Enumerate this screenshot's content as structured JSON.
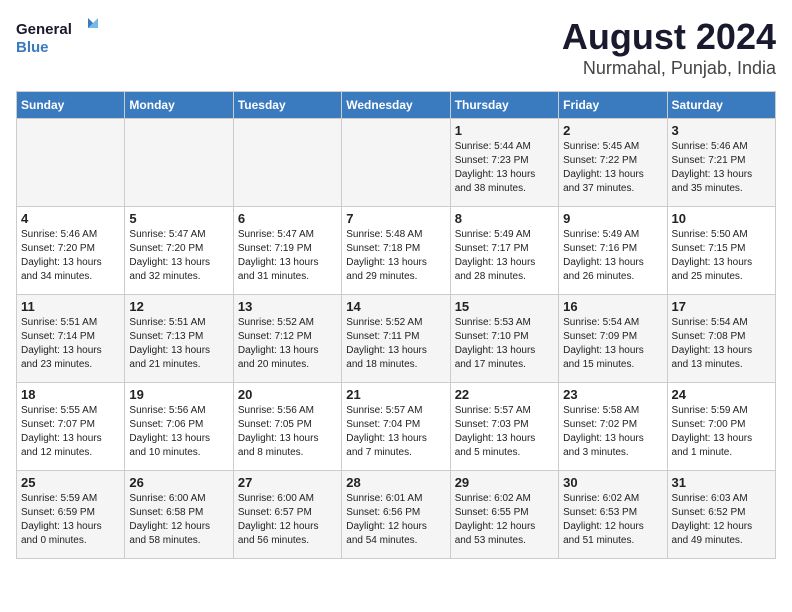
{
  "header": {
    "logo_line1": "General",
    "logo_line2": "Blue",
    "title": "August 2024",
    "subtitle": "Nurmahal, Punjab, India"
  },
  "days_of_week": [
    "Sunday",
    "Monday",
    "Tuesday",
    "Wednesday",
    "Thursday",
    "Friday",
    "Saturday"
  ],
  "weeks": [
    [
      {
        "day": "",
        "info": ""
      },
      {
        "day": "",
        "info": ""
      },
      {
        "day": "",
        "info": ""
      },
      {
        "day": "",
        "info": ""
      },
      {
        "day": "1",
        "info": "Sunrise: 5:44 AM\nSunset: 7:23 PM\nDaylight: 13 hours\nand 38 minutes."
      },
      {
        "day": "2",
        "info": "Sunrise: 5:45 AM\nSunset: 7:22 PM\nDaylight: 13 hours\nand 37 minutes."
      },
      {
        "day": "3",
        "info": "Sunrise: 5:46 AM\nSunset: 7:21 PM\nDaylight: 13 hours\nand 35 minutes."
      }
    ],
    [
      {
        "day": "4",
        "info": "Sunrise: 5:46 AM\nSunset: 7:20 PM\nDaylight: 13 hours\nand 34 minutes."
      },
      {
        "day": "5",
        "info": "Sunrise: 5:47 AM\nSunset: 7:20 PM\nDaylight: 13 hours\nand 32 minutes."
      },
      {
        "day": "6",
        "info": "Sunrise: 5:47 AM\nSunset: 7:19 PM\nDaylight: 13 hours\nand 31 minutes."
      },
      {
        "day": "7",
        "info": "Sunrise: 5:48 AM\nSunset: 7:18 PM\nDaylight: 13 hours\nand 29 minutes."
      },
      {
        "day": "8",
        "info": "Sunrise: 5:49 AM\nSunset: 7:17 PM\nDaylight: 13 hours\nand 28 minutes."
      },
      {
        "day": "9",
        "info": "Sunrise: 5:49 AM\nSunset: 7:16 PM\nDaylight: 13 hours\nand 26 minutes."
      },
      {
        "day": "10",
        "info": "Sunrise: 5:50 AM\nSunset: 7:15 PM\nDaylight: 13 hours\nand 25 minutes."
      }
    ],
    [
      {
        "day": "11",
        "info": "Sunrise: 5:51 AM\nSunset: 7:14 PM\nDaylight: 13 hours\nand 23 minutes."
      },
      {
        "day": "12",
        "info": "Sunrise: 5:51 AM\nSunset: 7:13 PM\nDaylight: 13 hours\nand 21 minutes."
      },
      {
        "day": "13",
        "info": "Sunrise: 5:52 AM\nSunset: 7:12 PM\nDaylight: 13 hours\nand 20 minutes."
      },
      {
        "day": "14",
        "info": "Sunrise: 5:52 AM\nSunset: 7:11 PM\nDaylight: 13 hours\nand 18 minutes."
      },
      {
        "day": "15",
        "info": "Sunrise: 5:53 AM\nSunset: 7:10 PM\nDaylight: 13 hours\nand 17 minutes."
      },
      {
        "day": "16",
        "info": "Sunrise: 5:54 AM\nSunset: 7:09 PM\nDaylight: 13 hours\nand 15 minutes."
      },
      {
        "day": "17",
        "info": "Sunrise: 5:54 AM\nSunset: 7:08 PM\nDaylight: 13 hours\nand 13 minutes."
      }
    ],
    [
      {
        "day": "18",
        "info": "Sunrise: 5:55 AM\nSunset: 7:07 PM\nDaylight: 13 hours\nand 12 minutes."
      },
      {
        "day": "19",
        "info": "Sunrise: 5:56 AM\nSunset: 7:06 PM\nDaylight: 13 hours\nand 10 minutes."
      },
      {
        "day": "20",
        "info": "Sunrise: 5:56 AM\nSunset: 7:05 PM\nDaylight: 13 hours\nand 8 minutes."
      },
      {
        "day": "21",
        "info": "Sunrise: 5:57 AM\nSunset: 7:04 PM\nDaylight: 13 hours\nand 7 minutes."
      },
      {
        "day": "22",
        "info": "Sunrise: 5:57 AM\nSunset: 7:03 PM\nDaylight: 13 hours\nand 5 minutes."
      },
      {
        "day": "23",
        "info": "Sunrise: 5:58 AM\nSunset: 7:02 PM\nDaylight: 13 hours\nand 3 minutes."
      },
      {
        "day": "24",
        "info": "Sunrise: 5:59 AM\nSunset: 7:00 PM\nDaylight: 13 hours\nand 1 minute."
      }
    ],
    [
      {
        "day": "25",
        "info": "Sunrise: 5:59 AM\nSunset: 6:59 PM\nDaylight: 13 hours\nand 0 minutes."
      },
      {
        "day": "26",
        "info": "Sunrise: 6:00 AM\nSunset: 6:58 PM\nDaylight: 12 hours\nand 58 minutes."
      },
      {
        "day": "27",
        "info": "Sunrise: 6:00 AM\nSunset: 6:57 PM\nDaylight: 12 hours\nand 56 minutes."
      },
      {
        "day": "28",
        "info": "Sunrise: 6:01 AM\nSunset: 6:56 PM\nDaylight: 12 hours\nand 54 minutes."
      },
      {
        "day": "29",
        "info": "Sunrise: 6:02 AM\nSunset: 6:55 PM\nDaylight: 12 hours\nand 53 minutes."
      },
      {
        "day": "30",
        "info": "Sunrise: 6:02 AM\nSunset: 6:53 PM\nDaylight: 12 hours\nand 51 minutes."
      },
      {
        "day": "31",
        "info": "Sunrise: 6:03 AM\nSunset: 6:52 PM\nDaylight: 12 hours\nand 49 minutes."
      }
    ]
  ]
}
